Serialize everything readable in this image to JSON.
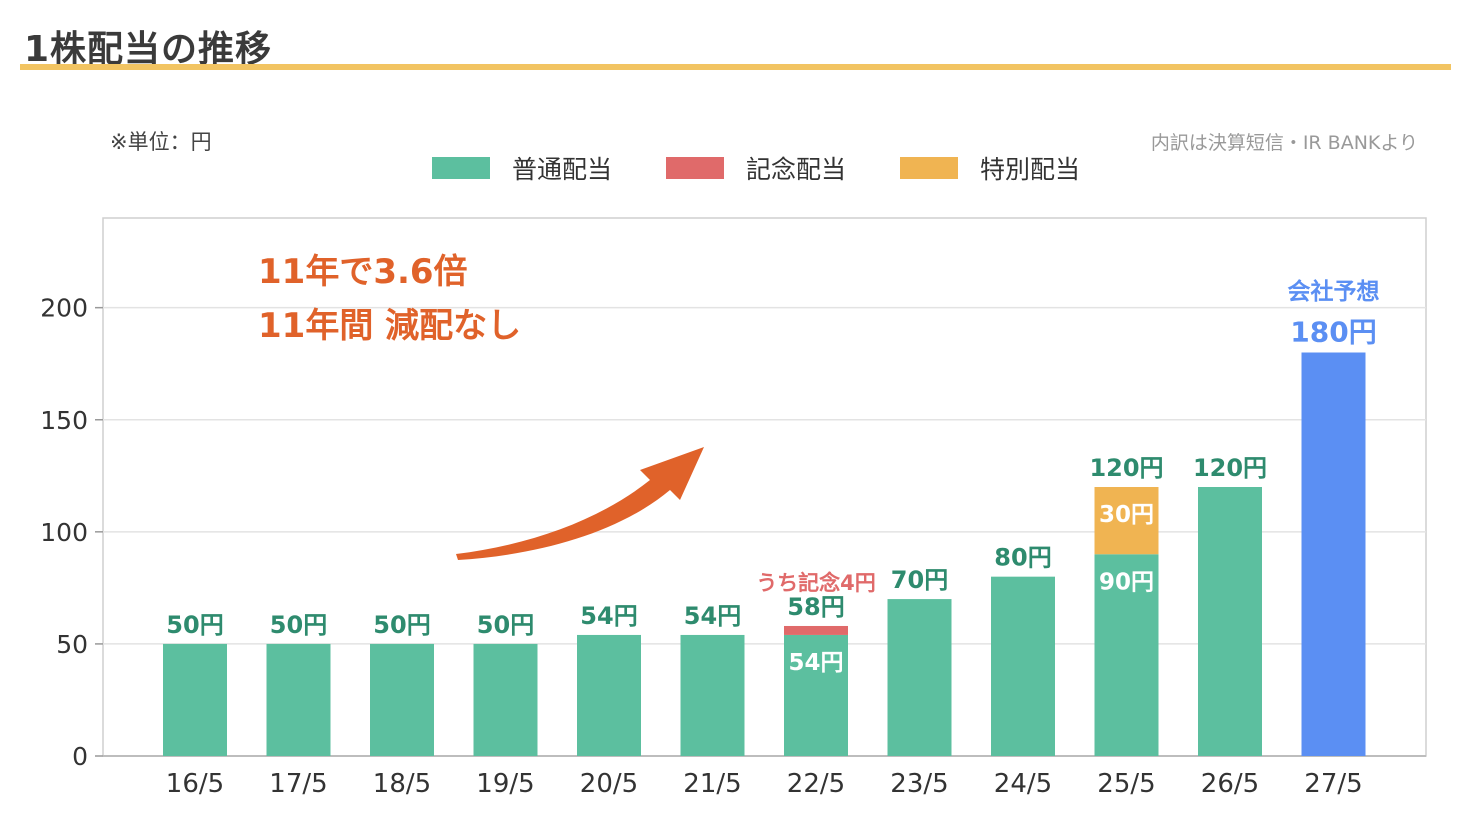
{
  "page": {
    "title": "1株配当の推移",
    "unit_note": "※単位：円",
    "source_note": "内訳は決算短信・IR BANKより"
  },
  "colors": {
    "regular": "#5cbf9f",
    "commemorative": "#e06a6a",
    "special": "#f0b452",
    "forecast": "#5b8ff3",
    "label_green": "#2e8b6e",
    "annotation_orange": "#e0622a",
    "title_rule": "#f2c462"
  },
  "chart_data": {
    "type": "bar",
    "stacked": true,
    "categories": [
      "16/5",
      "17/5",
      "18/5",
      "19/5",
      "20/5",
      "21/5",
      "22/5",
      "23/5",
      "24/5",
      "25/5",
      "26/5",
      "27/5"
    ],
    "series": [
      {
        "name": "普通配当",
        "key": "regular",
        "values": [
          50,
          50,
          50,
          50,
          54,
          54,
          54,
          70,
          80,
          90,
          120,
          0
        ]
      },
      {
        "name": "記念配当",
        "key": "commemorative",
        "values": [
          0,
          0,
          0,
          0,
          0,
          0,
          4,
          0,
          0,
          0,
          0,
          0
        ]
      },
      {
        "name": "特別配当",
        "key": "special",
        "values": [
          0,
          0,
          0,
          0,
          0,
          0,
          0,
          0,
          0,
          30,
          0,
          0
        ]
      },
      {
        "key": "forecast",
        "values": [
          0,
          0,
          0,
          0,
          0,
          0,
          0,
          0,
          0,
          0,
          0,
          180
        ]
      }
    ],
    "ylim": [
      0,
      240
    ],
    "yticks": [
      0,
      50,
      100,
      150,
      200
    ],
    "grid": true,
    "legend_position": "top-center",
    "total_labels": [
      "50円",
      "50円",
      "50円",
      "50円",
      "54円",
      "54円",
      "58円",
      "70円",
      "80円",
      "120円",
      "120円",
      "180円"
    ],
    "inner_labels": [
      {
        "category": "22/5",
        "series": "regular",
        "text": "54円"
      },
      {
        "category": "25/5",
        "series": "regular",
        "text": "90円"
      },
      {
        "category": "25/5",
        "series": "special",
        "text": "30円"
      }
    ],
    "annotations": {
      "commemorative_note": "うち記念4円",
      "forecast_note": "会社予想",
      "growth_line1": "11年で3.6倍",
      "growth_line2": "11年間 減配なし"
    }
  }
}
